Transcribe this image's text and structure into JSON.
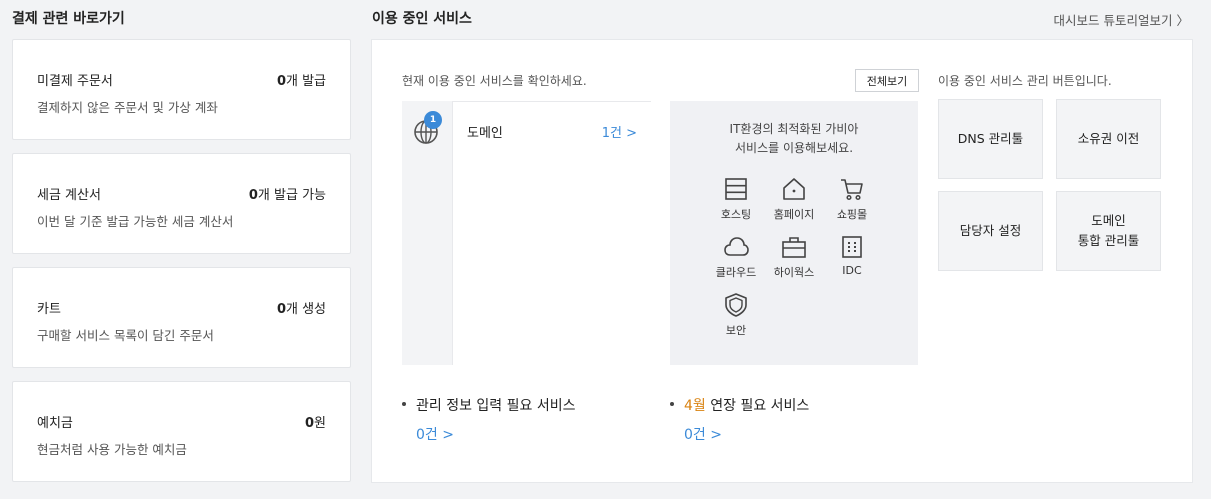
{
  "left": {
    "title": "결제 관련 바로가기",
    "cards": [
      {
        "title": "미결제 주문서",
        "value_num": "0",
        "value_suffix": "개 발급",
        "desc": "결제하지 않은 주문서 및 가상 계좌"
      },
      {
        "title": "세금 계산서",
        "value_num": "0",
        "value_suffix": "개 발급 가능",
        "desc": "이번 달 기준 발급 가능한 세금 계산서"
      },
      {
        "title": "카트",
        "value_num": "0",
        "value_suffix": "개 생성",
        "desc": "구매할 서비스 목록이 담긴 주문서"
      },
      {
        "title": "예치금",
        "value_num": "0",
        "value_suffix": "원",
        "desc": "현금처럼 사용 가능한 예치금"
      }
    ]
  },
  "services": {
    "title": "이용 중인 서비스",
    "tutorial_link": "대시보드 튜토리얼보기 〉",
    "intro": "현재 이용 중인 서비스를 확인하세요.",
    "view_all": "전체보기",
    "items": [
      {
        "badge": "1",
        "icon": "globe-icon",
        "name": "도메인",
        "count": "1건 >"
      }
    ],
    "promo": {
      "line1": "IT환경의 최적화된 가비아",
      "line2": "서비스를 이용해보세요.",
      "items": [
        {
          "label": "호스팅",
          "icon": "server-icon"
        },
        {
          "label": "홈페이지",
          "icon": "home-icon"
        },
        {
          "label": "쇼핑몰",
          "icon": "cart-icon"
        },
        {
          "label": "클라우드",
          "icon": "cloud-icon"
        },
        {
          "label": "하이웍스",
          "icon": "briefcase-icon"
        },
        {
          "label": "IDC",
          "icon": "building-icon"
        },
        {
          "label": "보안",
          "icon": "shield-icon"
        }
      ]
    },
    "management": {
      "intro": "이용 중인 서비스 관리 버튼입니다.",
      "buttons": [
        {
          "line1": "DNS 관리툴",
          "line2": ""
        },
        {
          "line1": "소유권 이전",
          "line2": ""
        },
        {
          "line1": "담당자 설정",
          "line2": ""
        },
        {
          "line1": "도메인",
          "line2": "통합 관리툴"
        }
      ]
    },
    "required_info": {
      "label": "관리 정보 입력 필요 서비스",
      "count": "0건 >"
    },
    "renewal": {
      "month": "4월",
      "label": " 연장 필요 서비스",
      "count": "0건 >"
    }
  }
}
